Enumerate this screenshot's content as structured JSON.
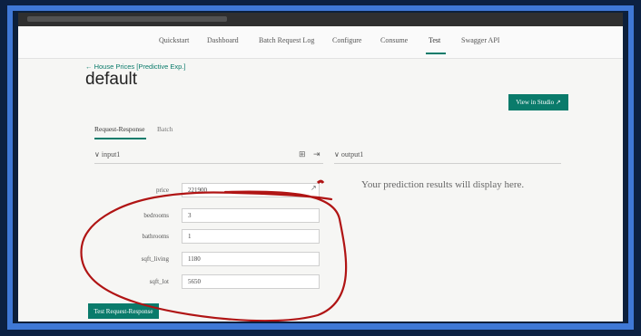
{
  "nav": {
    "items": [
      "Quickstart",
      "Dashboard",
      "Batch Request Log",
      "Configure",
      "Consume",
      "Test",
      "Swagger API"
    ],
    "active": "Test"
  },
  "header": {
    "back_link": "← House Prices [Predictive Exp.]",
    "title": "default",
    "studio_button": "View in Studio ↗"
  },
  "tabs": [
    "Request-Response",
    "Batch"
  ],
  "input_panel": {
    "title": "∨  input1"
  },
  "output_panel": {
    "title": "∨  output1",
    "placeholder": "Your prediction results will display here."
  },
  "fields": [
    {
      "label": "price",
      "value": "221900"
    },
    {
      "label": "bedrooms",
      "value": "3"
    },
    {
      "label": "bathrooms",
      "value": "1"
    },
    {
      "label": "sqft_living",
      "value": "1180"
    },
    {
      "label": "sqft_lot",
      "value": "5650"
    }
  ],
  "test_button": "Test Request-Response",
  "colors": {
    "accent": "#0a7b6b",
    "annotation": "#b01414",
    "frame": "#3f78d6"
  }
}
